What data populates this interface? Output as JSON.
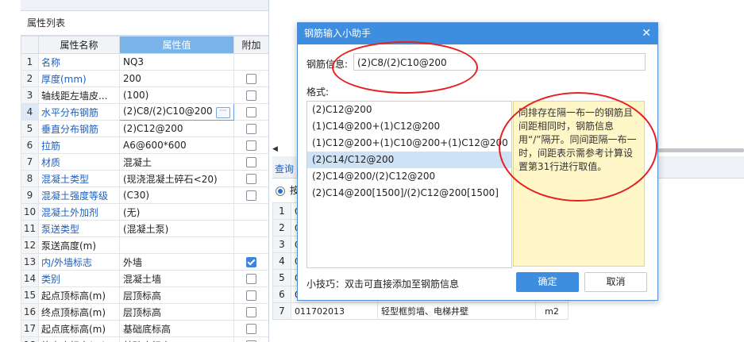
{
  "property_panel": {
    "title": "属性列表",
    "headers": {
      "name": "属性名称",
      "value": "属性值",
      "extra": "附加"
    },
    "rows": [
      {
        "num": "1",
        "name": "名称",
        "value": "NQ3",
        "blue": true,
        "checkbox": null
      },
      {
        "num": "2",
        "name": "厚度(mm)",
        "value": "200",
        "blue": true,
        "checkbox": false
      },
      {
        "num": "3",
        "name": "轴线距左墙皮...",
        "value": "(100)",
        "blue": false,
        "checkbox": false
      },
      {
        "num": "4",
        "name": "水平分布钢筋",
        "value": "(2)C8/(2)C10@200",
        "blue": true,
        "checkbox": false
      },
      {
        "num": "5",
        "name": "垂直分布钢筋",
        "value": "(2)C12@200",
        "blue": true,
        "checkbox": false
      },
      {
        "num": "6",
        "name": "拉筋",
        "value": "A6@600*600",
        "blue": true,
        "checkbox": false
      },
      {
        "num": "7",
        "name": "材质",
        "value": "混凝土",
        "blue": true,
        "checkbox": false
      },
      {
        "num": "8",
        "name": "混凝土类型",
        "value": "(现浇混凝土碎石<20)",
        "blue": true,
        "checkbox": false
      },
      {
        "num": "9",
        "name": "混凝土强度等级",
        "value": "(C30)",
        "blue": true,
        "checkbox": false
      },
      {
        "num": "10",
        "name": "混凝土外加剂",
        "value": "(无)",
        "blue": true,
        "checkbox": null
      },
      {
        "num": "11",
        "name": "泵送类型",
        "value": "(混凝土泵)",
        "blue": true,
        "checkbox": null
      },
      {
        "num": "12",
        "name": "泵送高度(m)",
        "value": "",
        "blue": false,
        "checkbox": null
      },
      {
        "num": "13",
        "name": "内/外墙标志",
        "value": "外墙",
        "blue": true,
        "checkbox": true
      },
      {
        "num": "14",
        "name": "类别",
        "value": "混凝土墙",
        "blue": true,
        "checkbox": false
      },
      {
        "num": "15",
        "name": "起点顶标高(m)",
        "value": "层顶标高",
        "blue": false,
        "checkbox": false
      },
      {
        "num": "16",
        "name": "终点顶标高(m)",
        "value": "层顶标高",
        "blue": false,
        "checkbox": false
      },
      {
        "num": "17",
        "name": "起点底标高(m)",
        "value": "基础底标高",
        "blue": false,
        "checkbox": false
      },
      {
        "num": "18",
        "name": "终点底标高(m)",
        "value": "基础底标高",
        "blue": false,
        "checkbox": false
      }
    ],
    "active_row": "4"
  },
  "background_panel": {
    "tab_label": "查询",
    "radio_label": "按",
    "rows": [
      {
        "num": "1",
        "code": "01",
        "name": "",
        "unit": ""
      },
      {
        "num": "2",
        "code": "01",
        "name": "",
        "unit": ""
      },
      {
        "num": "3",
        "code": "01",
        "name": "",
        "unit": ""
      },
      {
        "num": "4",
        "code": "01",
        "name": "",
        "unit": ""
      },
      {
        "num": "5",
        "code": "01",
        "name": "",
        "unit": ""
      },
      {
        "num": "6",
        "code": "011702012",
        "name": "弧形墙",
        "unit": "m2"
      },
      {
        "num": "7",
        "code": "011702013",
        "name": "轻型框剪墙、电梯井壁",
        "unit": "m2"
      }
    ]
  },
  "dialog": {
    "title": "钢筋输入小助手",
    "close_glyph": "✕",
    "info_label": "钢筋信息:",
    "info_value": "(2)C8/(2)C10@200",
    "format_label": "格式:",
    "formats": [
      "(2)C12@200",
      "(1)C14@200+(1)C12@200",
      "(1)C12@200+(1)C10@200+(1)C12@200",
      "(2)C14/C12@200",
      "(2)C14@200/(2)C12@200",
      "(2)C14@200[1500]/(2)C12@200[1500]"
    ],
    "selected_format_index": 3,
    "note": "同排存在隔一布一的钢筋且间距相同时，钢筋信息用“/”隔开。同间距隔一布一时，间距表示需参考计算设置第31行进行取值。",
    "tip": "小技巧：双击可直接添加至钢筋信息",
    "ok_label": "确定",
    "cancel_label": "取消"
  },
  "colors": {
    "accent_blue": "#3d8ee0",
    "annotation_red": "#e62020",
    "note_background": "#fff7c7",
    "selected_header": "#7ab3e9"
  }
}
